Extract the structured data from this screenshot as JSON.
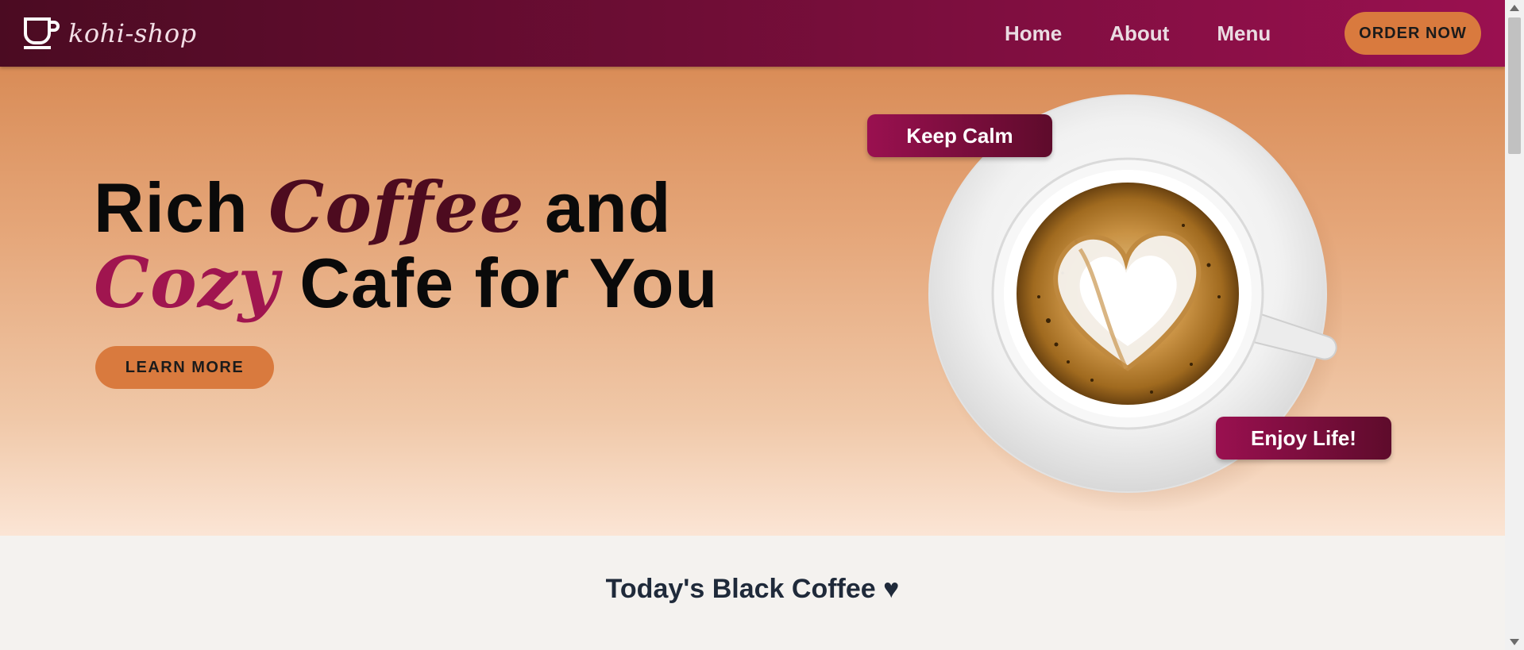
{
  "brand": {
    "name": "kohi-shop",
    "icon": "coffee-cup-icon"
  },
  "nav": {
    "links": [
      "Home",
      "About",
      "Menu"
    ],
    "order_label": "ORDER NOW"
  },
  "hero": {
    "line1_a": "Rich ",
    "line1_script": "Coffee",
    "line1_b": " and",
    "line2_script": "Cozy",
    "line2_b": " Cafe for You",
    "learn_label": "LEARN MORE",
    "tag_calm": "Keep Calm",
    "tag_enjoy": "Enjoy Life!",
    "image": "latte-art-cup"
  },
  "section": {
    "title": "Today's Black Coffee ♥"
  },
  "colors": {
    "nav_start": "#4b0b22",
    "nav_end": "#9a1050",
    "accent_orange": "#d97a3e",
    "script_dark": "#4d0b1f",
    "script_pink": "#a0154f"
  }
}
